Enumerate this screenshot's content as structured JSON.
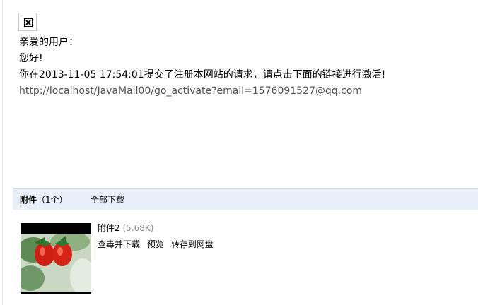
{
  "mail": {
    "image_icon": "broken-image-icon",
    "greeting": "亲爱的用户：",
    "hello": "您好!",
    "notice": "你在2013-11-05 17:54:01提交了注册本网站的请求，请点击下面的链接进行激活!",
    "activate_link": "http://localhost/JavaMail00/go_activate?email=1576091527@qq.com"
  },
  "attachments": {
    "title": "附件",
    "count": "（1个）",
    "download_all": "全部下载",
    "items": [
      {
        "name": "附件2",
        "size": "(5.68K)",
        "thumbnail_icon": "strawberry-thumbnail",
        "actions": [
          "查毒并下载",
          "预览",
          "转存到网盘"
        ]
      }
    ]
  },
  "colors": {
    "link": "#505050",
    "attachment_bar": "#e8eff8",
    "size_text": "#8a8a8a"
  }
}
